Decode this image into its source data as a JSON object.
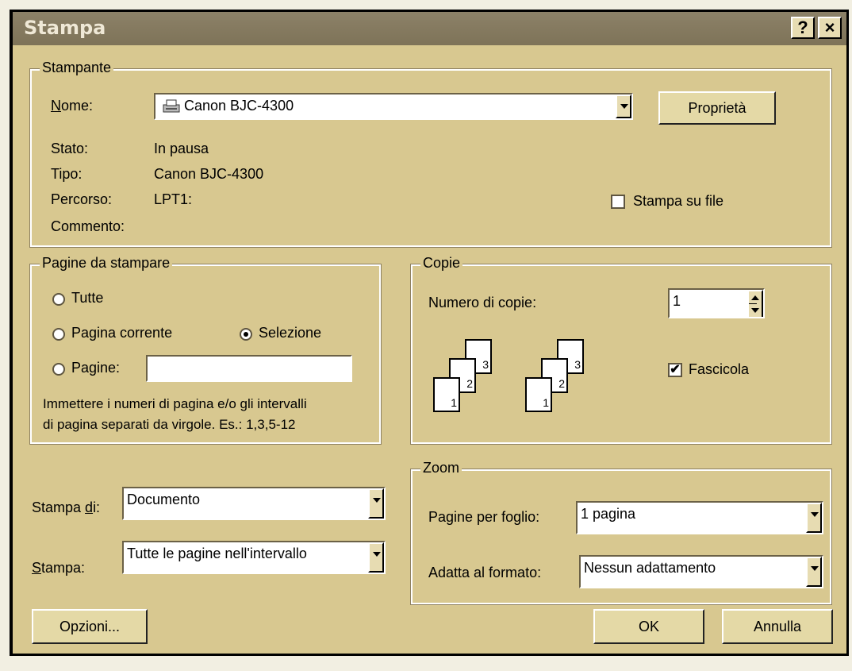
{
  "window": {
    "title": "Stampa",
    "help": "?",
    "close": "×"
  },
  "printer": {
    "legend": "Stampante",
    "name_label": "Nome:",
    "name_value": "Canon BJC-4300",
    "properties_button": "Proprietà",
    "status_label": "Stato:",
    "status_value": "In pausa",
    "type_label": "Tipo:",
    "type_value": "Canon BJC-4300",
    "path_label": "Percorso:",
    "path_value": "LPT1:",
    "comment_label": "Commento:",
    "print_to_file": "Stampa su file",
    "print_to_file_checked": false
  },
  "pages": {
    "legend": "Pagine da stampare",
    "all": "Tutte",
    "current": "Pagina corrente",
    "selection": "Selezione",
    "selected": "selection",
    "range": "Pagine:",
    "range_value": "",
    "hint1": "Immettere i numeri di pagina e/o gli intervalli",
    "hint2": "di pagina separati da virgole. Es.: 1,3,5-12"
  },
  "copies": {
    "legend": "Copie",
    "number_label": "Numero di copie:",
    "number_value": "1",
    "collate": "Fascicola",
    "collate_checked": true,
    "page_nums": [
      "3",
      "2",
      "1"
    ]
  },
  "print_what": {
    "label": "Stampa di:",
    "value": "Documento"
  },
  "print": {
    "label": "Stampa:",
    "value": "Tutte le pagine nell'intervallo"
  },
  "zoom": {
    "legend": "Zoom",
    "pages_per_sheet_label": "Pagine per foglio:",
    "pages_per_sheet_value": "1 pagina",
    "scale_label": "Adatta al formato:",
    "scale_value": "Nessun adattamento"
  },
  "buttons": {
    "options": "Opzioni...",
    "ok": "OK",
    "cancel": "Annulla"
  }
}
